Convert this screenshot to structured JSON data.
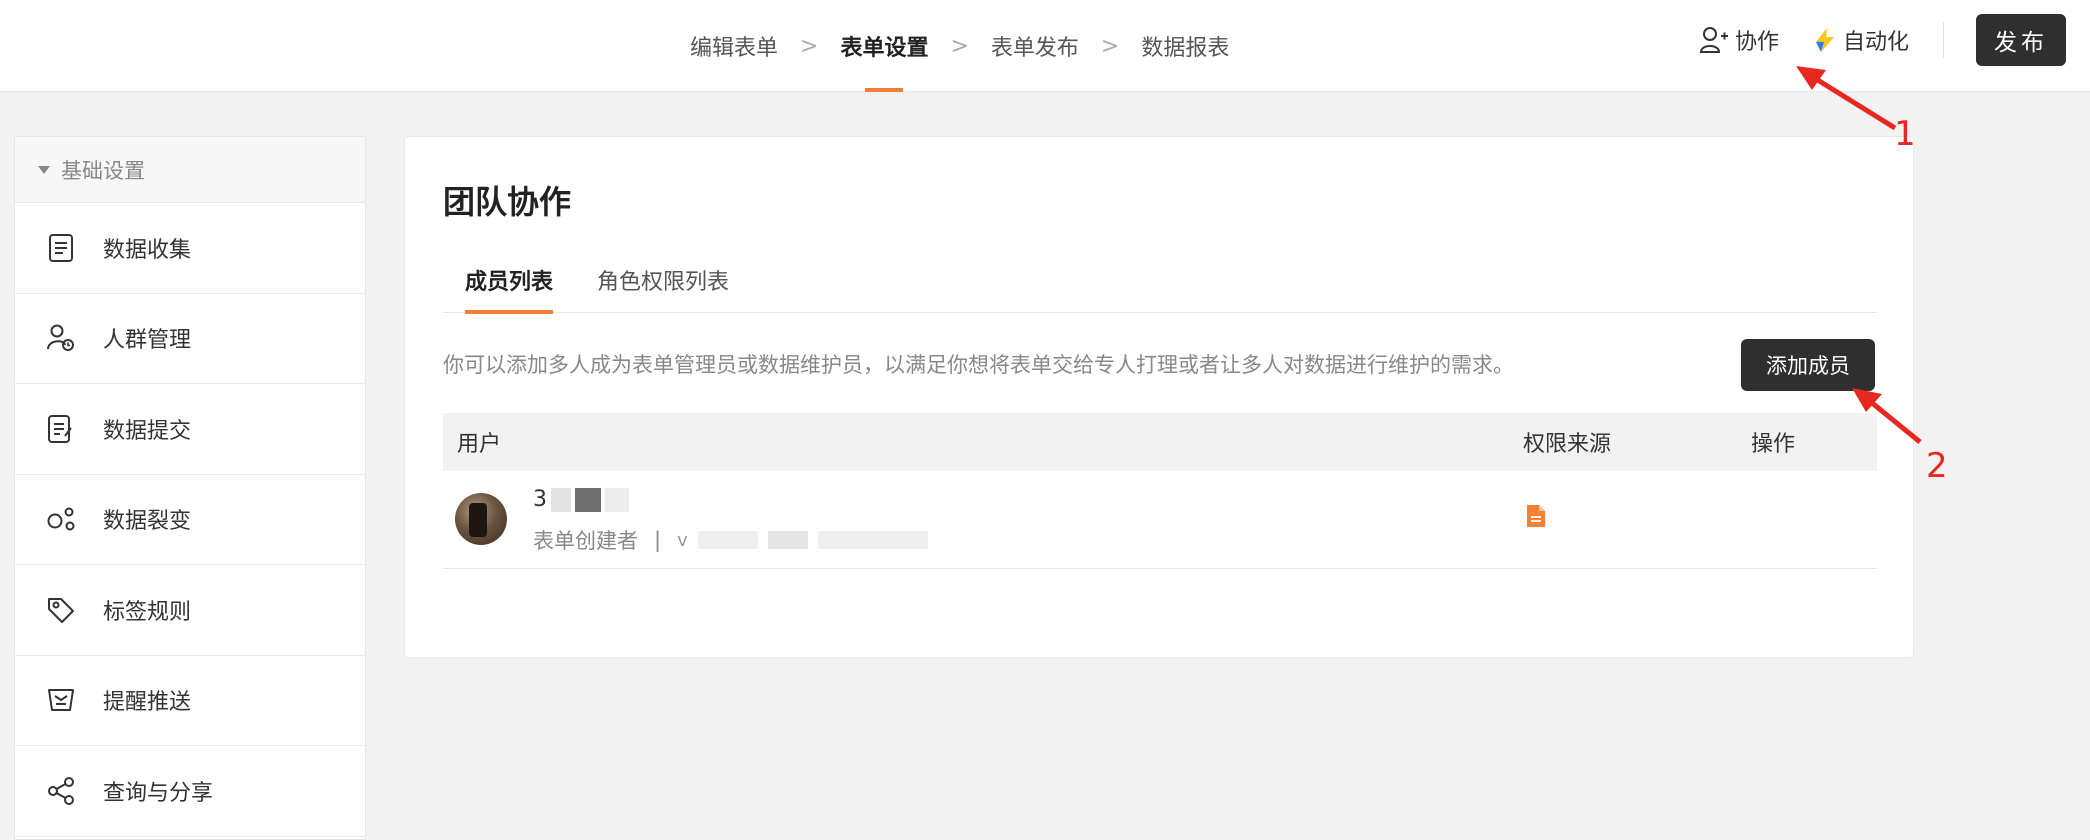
{
  "topbar": {
    "steps": [
      "编辑表单",
      "表单设置",
      "表单发布",
      "数据报表"
    ],
    "separator": ">",
    "collab_label": "协作",
    "automation_label": "自动化",
    "publish_label": "发布"
  },
  "sidebar": {
    "section_title": "基础设置",
    "items": [
      {
        "label": "数据收集",
        "icon": "list-doc-icon"
      },
      {
        "label": "人群管理",
        "icon": "user-group-icon"
      },
      {
        "label": "数据提交",
        "icon": "submit-doc-icon"
      },
      {
        "label": "数据裂变",
        "icon": "fission-icon"
      },
      {
        "label": "标签规则",
        "icon": "tag-icon"
      },
      {
        "label": "提醒推送",
        "icon": "notify-icon"
      },
      {
        "label": "查询与分享",
        "icon": "share-icon"
      }
    ]
  },
  "main": {
    "title": "团队协作",
    "tabs": [
      "成员列表",
      "角色权限列表"
    ],
    "description": "你可以添加多人成为表单管理员或数据维护员，以满足你想将表单交给专人打理或者让多人对数据进行维护的需求。",
    "add_member_label": "添加成员",
    "table": {
      "headers": [
        "用户",
        "权限来源",
        "操作"
      ],
      "rows": [
        {
          "name_initial": "3",
          "role": "表单创建者",
          "role_sep": "|",
          "extra_initial": "v"
        }
      ]
    }
  },
  "annotations": {
    "labels": [
      "1",
      "2"
    ],
    "color": "#e8281f"
  },
  "colors": {
    "accent": "#f57f32",
    "dark_button": "#2f2f2f"
  }
}
